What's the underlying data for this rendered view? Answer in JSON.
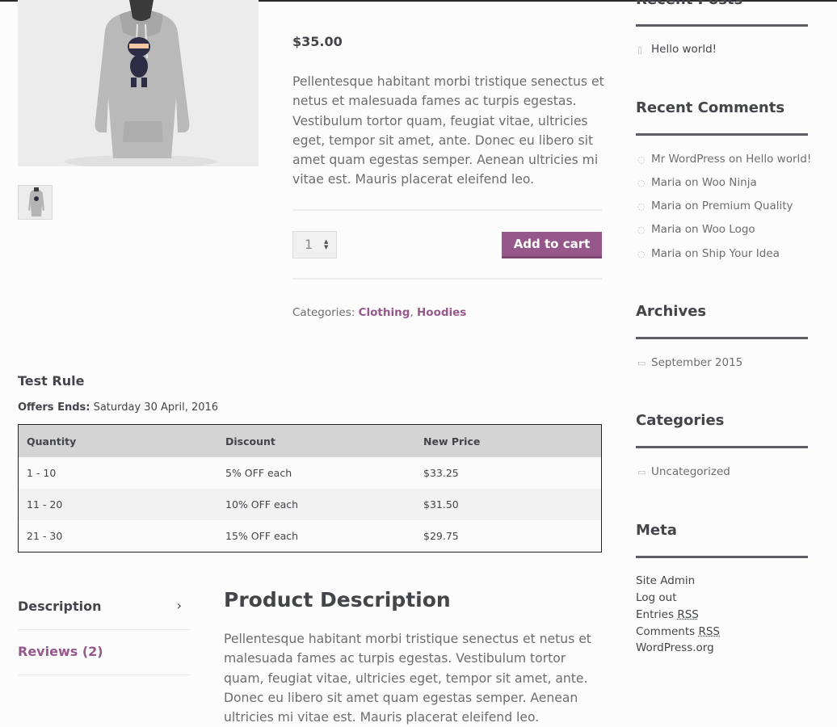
{
  "product": {
    "price": "$35.00",
    "short_description": "Pellentesque habitant morbi tristique senectus et netus et malesuada fames ac turpis egestas. Vestibulum tortor quam, feugiat vitae, ultricies eget, tempor sit amet, ante. Donec eu libero sit amet quam egestas semper. Aenean ultricies mi vitae est. Mauris placerat eleifend leo.",
    "quantity": "1",
    "add_to_cart_label": "Add to cart",
    "categories_label": "Categories:",
    "categories": [
      "Clothing",
      "Hoodies"
    ],
    "category_separator": ",",
    "accent_color": "#96588a"
  },
  "rule": {
    "title": "Test Rule",
    "offer_label": "Offers Ends:",
    "offer_date": "Saturday 30 April, 2016",
    "headers": [
      "Quantity",
      "Discount",
      "New Price"
    ],
    "rows": [
      [
        "1 - 10",
        "5% OFF each",
        "$33.25"
      ],
      [
        "11 - 20",
        "10% OFF each",
        "$31.50"
      ],
      [
        "21 - 30",
        "15% OFF each",
        "$29.75"
      ]
    ]
  },
  "tabs": [
    {
      "label": "Description",
      "icon": "chevron-right-icon"
    },
    {
      "label": "Reviews (2)"
    }
  ],
  "description": {
    "title": "Product Description",
    "body": "Pellentesque habitant morbi tristique senectus et netus et malesuada fames ac turpis egestas. Vestibulum tortor quam, feugiat vitae, ultricies eget, tempor sit amet, ante. Donec eu libero sit amet quam egestas semper. Aenean ultricies mi vitae est. Mauris placerat eleifend leo."
  },
  "sidebar": {
    "recent_posts": {
      "title": "Recent Posts",
      "items": [
        "Hello world!"
      ],
      "icon": "document-icon"
    },
    "recent_comments": {
      "title": "Recent Comments",
      "icon": "comment-icon",
      "items": [
        {
          "author": "Mr WordPress",
          "on": "on",
          "post": "Hello world!"
        },
        {
          "author": "Maria",
          "on": "on",
          "post": "Woo Ninja"
        },
        {
          "author": "Maria",
          "on": "on",
          "post": "Premium Quality"
        },
        {
          "author": "Maria",
          "on": "on",
          "post": "Woo Logo"
        },
        {
          "author": "Maria",
          "on": "on",
          "post": "Ship Your Idea"
        }
      ]
    },
    "archives": {
      "title": "Archives",
      "items": [
        "September 2015"
      ],
      "icon": "folder-icon"
    },
    "categories": {
      "title": "Categories",
      "items": [
        "Uncategorized"
      ],
      "icon": "folder-icon"
    },
    "meta": {
      "title": "Meta",
      "items": [
        "Site Admin",
        "Log out",
        "Entries",
        "Comments",
        "WordPress.org"
      ],
      "rss": "RSS"
    }
  }
}
